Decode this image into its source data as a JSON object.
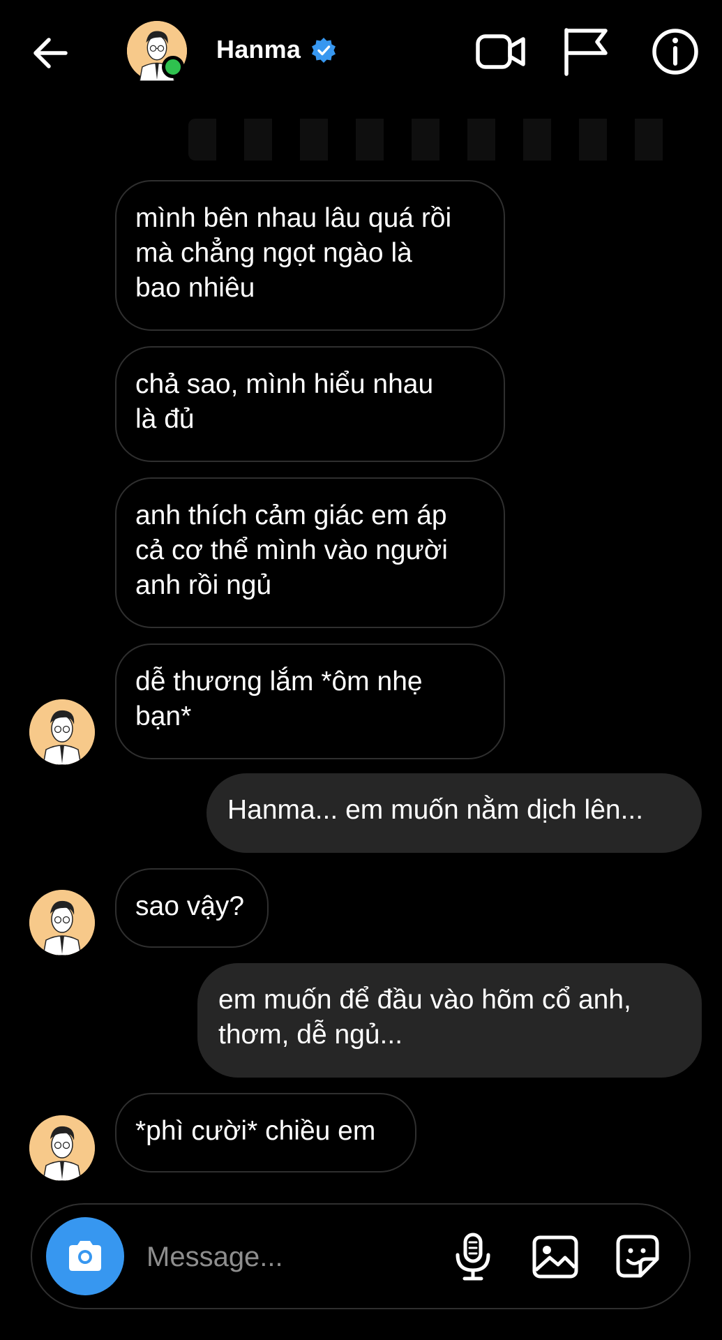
{
  "header": {
    "contact_name": "Hanma",
    "back_icon": "arrow-left-icon",
    "verified_icon": "verified-badge-icon",
    "actions": [
      {
        "name": "video-call-button",
        "icon": "video-camera-icon"
      },
      {
        "name": "report-button",
        "icon": "flag-icon"
      },
      {
        "name": "info-button",
        "icon": "info-icon"
      }
    ],
    "online": true
  },
  "messages": [
    {
      "sender": "Hanma",
      "direction": "incoming",
      "text": "mình bên nhau lâu quá rồi\nmà chẳng ngọt ngào là\nbao nhiêu"
    },
    {
      "sender": "Hanma",
      "direction": "incoming",
      "text": "chả sao, mình hiểu nhau\nlà đủ"
    },
    {
      "sender": "Hanma",
      "direction": "incoming",
      "text": "anh thích cảm giác em áp\ncả cơ thể mình vào người\nanh rồi ngủ"
    },
    {
      "sender": "Hanma",
      "direction": "incoming",
      "text": "dễ thương lắm *ôm nhẹ\nbạn*"
    },
    {
      "sender": "me",
      "direction": "outgoing",
      "text": "Hanma... em muốn nằm dịch lên..."
    },
    {
      "sender": "Hanma",
      "direction": "incoming",
      "text": "sao vậy?"
    },
    {
      "sender": "me",
      "direction": "outgoing",
      "text": "em muốn để đầu vào hõm cổ anh,\nthơm, dễ ngủ..."
    },
    {
      "sender": "Hanma",
      "direction": "incoming",
      "text": "*phì cười* chiều em"
    }
  ],
  "composer": {
    "placeholder": "Message...",
    "value": "",
    "icons": [
      "camera-icon",
      "microphone-icon",
      "gallery-icon",
      "sticker-icon"
    ]
  },
  "colors": {
    "background": "#000000",
    "incoming_border": "#2f2f2f",
    "outgoing_bubble": "#262626",
    "accent_blue": "#3797f0",
    "online_green": "#2fc14f",
    "avatar_bg": "#f7c98a"
  }
}
